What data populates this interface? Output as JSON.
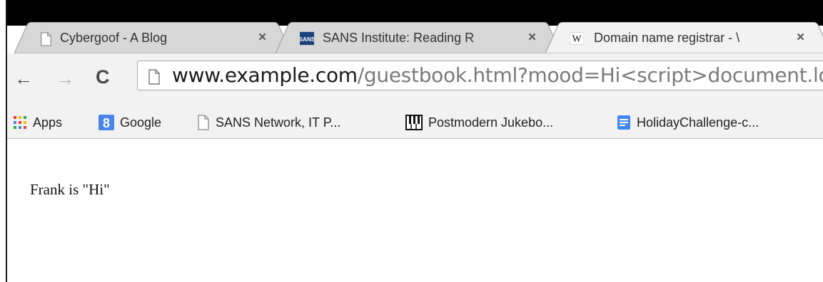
{
  "tabs": [
    {
      "title": "Cybergoof - A Blog",
      "favicon": "page-icon",
      "close": "×"
    },
    {
      "title": "SANS Institute: Reading R",
      "favicon": "sans-logo-icon",
      "close": "×"
    },
    {
      "title": "Domain name registrar - \\",
      "favicon": "wikipedia-icon",
      "close": "×"
    }
  ],
  "toolbar": {
    "back": "←",
    "forward": "→",
    "reload": "C"
  },
  "address": {
    "host": "www.example.com",
    "path": "/guestbook.html?mood=Hi<script>document.lo"
  },
  "bookmarks": [
    {
      "label": "Apps",
      "icon": "apps-grid-icon"
    },
    {
      "label": "Google",
      "icon": "google-icon"
    },
    {
      "label": "SANS Network, IT P...",
      "icon": "page-icon"
    },
    {
      "label": "Postmodern Jukebo...",
      "icon": "piano-icon"
    },
    {
      "label": "HolidayChallenge-c...",
      "icon": "docs-icon"
    }
  ],
  "page": {
    "text": "Frank is \"Hi\""
  },
  "colors": {
    "tab_active": "#f2f2f2",
    "tab_inactive": "#d7d7d7",
    "toolbar": "#f2f2f2",
    "url_host": "#1a1a1a",
    "url_path": "#7a7a7a"
  }
}
